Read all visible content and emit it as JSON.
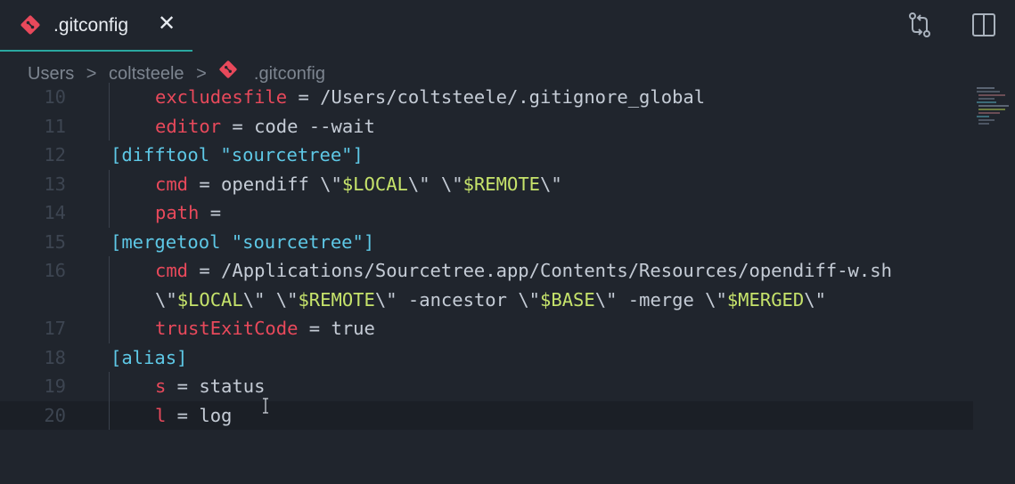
{
  "tab": {
    "label": ".gitconfig",
    "close": "✕",
    "accent": "#2aa8a0"
  },
  "toolbar": {
    "compare_icon": "git-compare-icon",
    "split_icon": "split-editor-icon"
  },
  "breadcrumb": {
    "items": [
      "Users",
      "coltsteele",
      ".gitconfig"
    ],
    "sep": ">"
  },
  "editor": {
    "lines": [
      {
        "num": "10",
        "indent": true,
        "tokens": [
          [
            "k",
            "excludesfile"
          ],
          [
            "p",
            " = /Users/coltsteele/.gitignore_global"
          ]
        ]
      },
      {
        "num": "11",
        "indent": true,
        "tokens": [
          [
            "k",
            "editor"
          ],
          [
            "p",
            " = code --wait"
          ]
        ]
      },
      {
        "num": "12",
        "indent": false,
        "tokens": [
          [
            "s",
            "[difftool \"sourcetree\"]"
          ]
        ]
      },
      {
        "num": "13",
        "indent": true,
        "tokens": [
          [
            "k",
            "cmd"
          ],
          [
            "p",
            " = opendiff \\\""
          ],
          [
            "v",
            "$LOCAL"
          ],
          [
            "p",
            "\\\" \\\""
          ],
          [
            "v",
            "$REMOTE"
          ],
          [
            "p",
            "\\\""
          ]
        ]
      },
      {
        "num": "14",
        "indent": true,
        "tokens": [
          [
            "k",
            "path"
          ],
          [
            "p",
            " ="
          ]
        ]
      },
      {
        "num": "15",
        "indent": false,
        "tokens": [
          [
            "s",
            "[mergetool \"sourcetree\"]"
          ]
        ]
      },
      {
        "num": "16",
        "indent": true,
        "tokens": [
          [
            "k",
            "cmd"
          ],
          [
            "p",
            " = /Applications/Sourcetree.app/Contents/Resources/opendiff-w.sh"
          ]
        ]
      },
      {
        "num": "",
        "indent": true,
        "tokens": [
          [
            "p",
            "\\\""
          ],
          [
            "v",
            "$LOCAL"
          ],
          [
            "p",
            "\\\" \\\""
          ],
          [
            "v",
            "$REMOTE"
          ],
          [
            "p",
            "\\\" -ancestor \\\""
          ],
          [
            "v",
            "$BASE"
          ],
          [
            "p",
            "\\\" -merge \\\""
          ],
          [
            "v",
            "$MERGED"
          ],
          [
            "p",
            "\\\""
          ]
        ]
      },
      {
        "num": "17",
        "indent": true,
        "tokens": [
          [
            "k",
            "trustExitCode"
          ],
          [
            "p",
            " = true"
          ]
        ]
      },
      {
        "num": "18",
        "indent": false,
        "tokens": [
          [
            "s",
            "[alias]"
          ]
        ]
      },
      {
        "num": "19",
        "indent": true,
        "tokens": [
          [
            "k",
            "s"
          ],
          [
            "p",
            " = status"
          ]
        ]
      },
      {
        "num": "20",
        "indent": true,
        "current": true,
        "tokens": [
          [
            "k",
            "l"
          ],
          [
            "p",
            " = log"
          ]
        ]
      }
    ]
  }
}
